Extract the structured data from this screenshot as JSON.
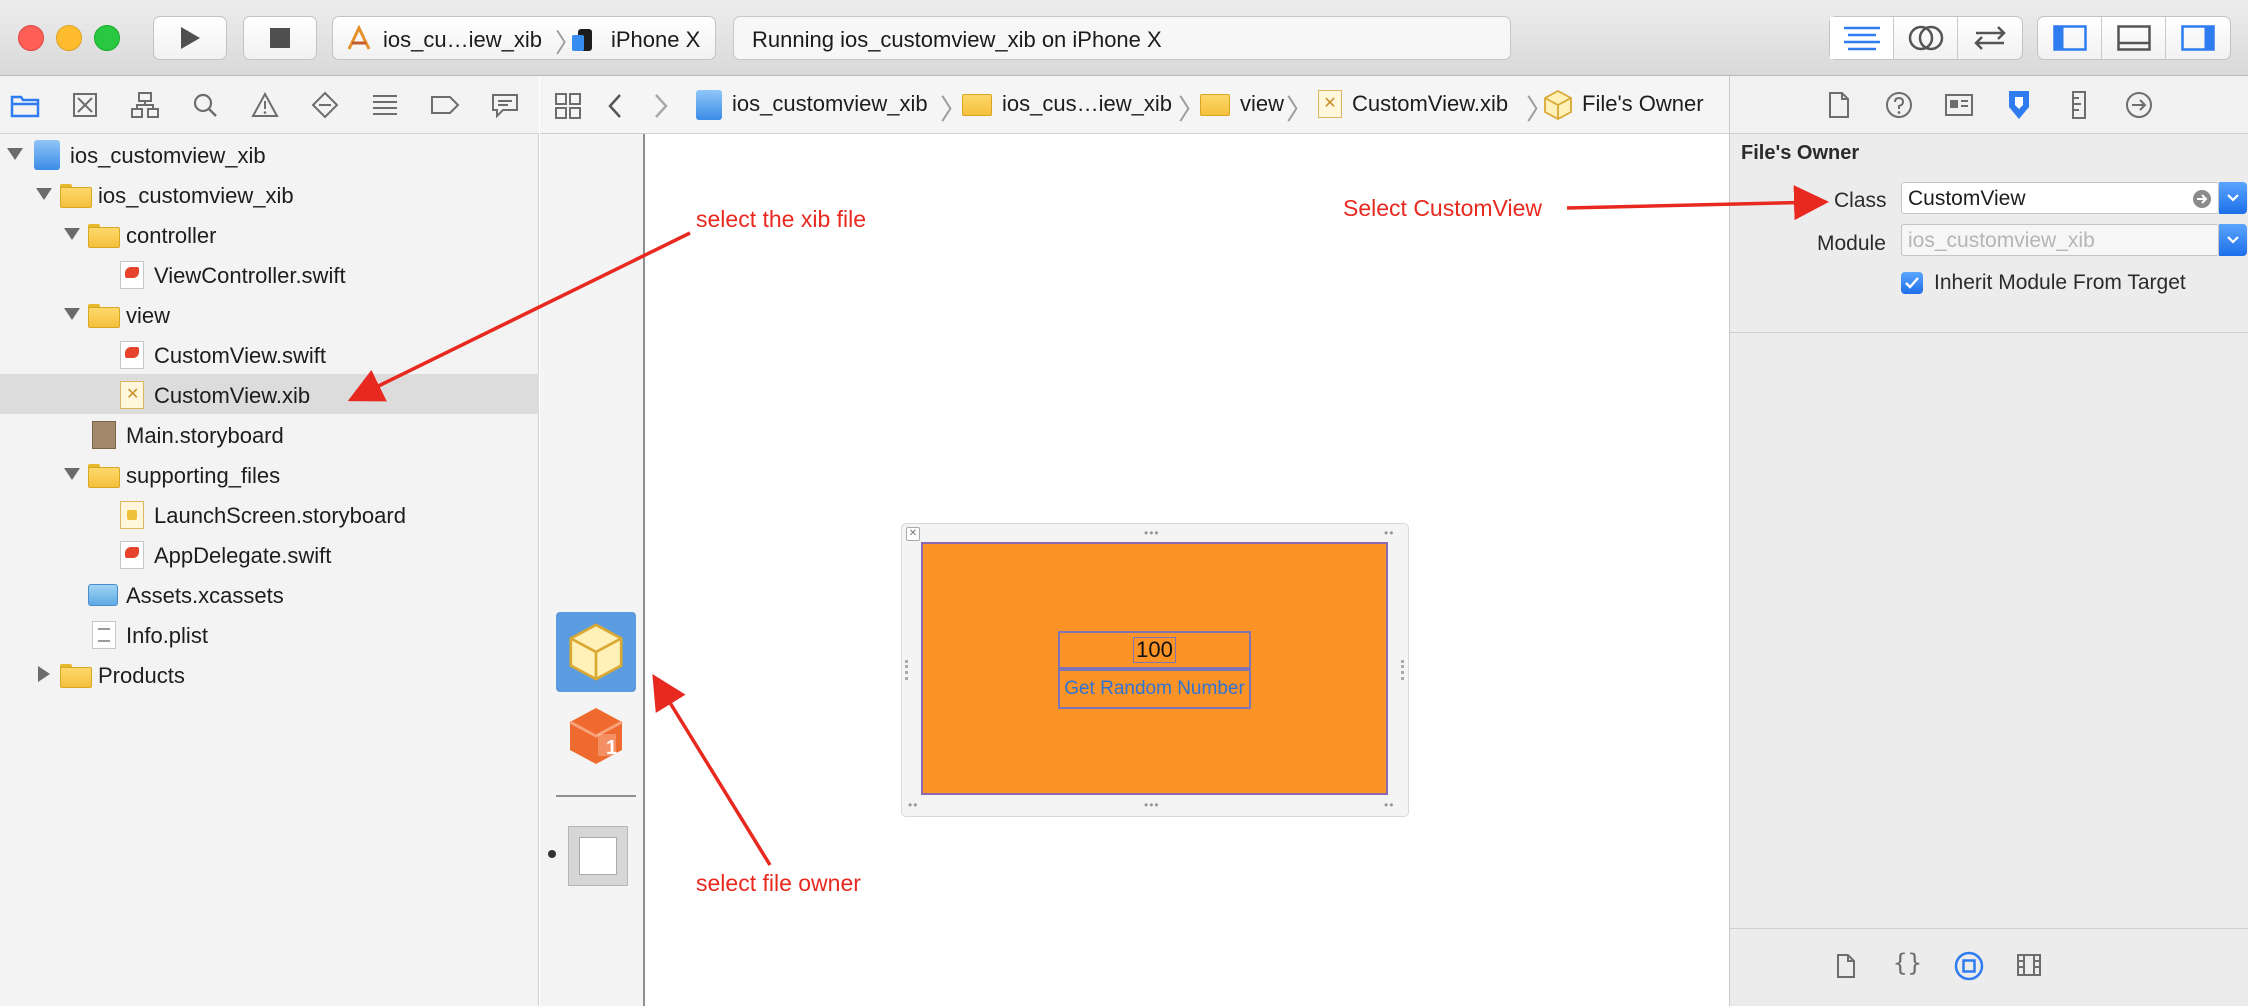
{
  "toolbar": {
    "run_icon": "play-icon",
    "stop_icon": "stop-icon",
    "scheme_name": "ios_cu…iew_xib",
    "device_name": "iPhone X",
    "activity_status": "Running ios_customview_xib on iPhone X",
    "editor_icons": [
      "standard-editor-icon",
      "assistant-editor-icon",
      "version-editor-icon"
    ],
    "panel_icons": [
      "navigator-toggle-icon",
      "debug-area-toggle-icon",
      "utilities-toggle-icon"
    ]
  },
  "navigator": {
    "tab_icons": [
      "folder-icon",
      "source-control-icon",
      "hierarchy-icon",
      "search-icon",
      "warning-icon",
      "test-icon",
      "debug-icon",
      "breakpoint-icon",
      "report-icon"
    ],
    "items": [
      {
        "label": "ios_customview_xib"
      },
      {
        "label": "ios_customview_xib"
      },
      {
        "label": "controller"
      },
      {
        "label": "ViewController.swift"
      },
      {
        "label": "view"
      },
      {
        "label": "CustomView.swift"
      },
      {
        "label": "CustomView.xib"
      },
      {
        "label": "Main.storyboard"
      },
      {
        "label": "supporting_files"
      },
      {
        "label": "LaunchScreen.storyboard"
      },
      {
        "label": "AppDelegate.swift"
      },
      {
        "label": "Assets.xcassets"
      },
      {
        "label": "Info.plist"
      },
      {
        "label": "Products"
      }
    ]
  },
  "jumpbar": {
    "crumbs": [
      "ios_customview_xib",
      "ios_cus…iew_xib",
      "view",
      "CustomView.xib",
      "File's Owner"
    ]
  },
  "canvas": {
    "label_text": "100",
    "button_text": "Get Random Number"
  },
  "inspector": {
    "section_title": "File's Owner",
    "class_label": "Class",
    "class_value": "CustomView",
    "module_label": "Module",
    "module_placeholder": "ios_customview_xib",
    "inherit_label": "Inherit Module From Target",
    "inherit_checked": true
  },
  "annotations": {
    "select_xib": "select the xib file",
    "select_owner": "select file owner",
    "select_class": "Select CustomView",
    "arrow_color": "#e8291f"
  },
  "colors": {
    "view_background": "#fb9327",
    "accent": "#1d6fe9"
  }
}
